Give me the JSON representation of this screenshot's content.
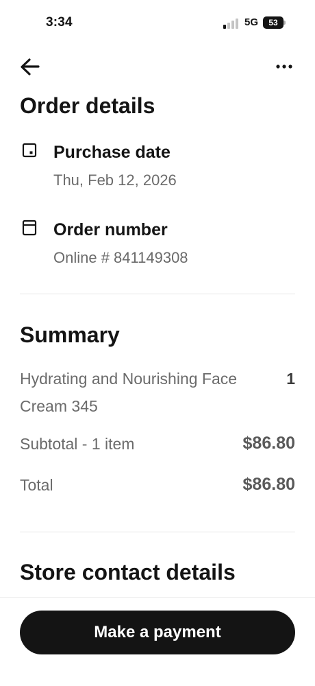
{
  "status_bar": {
    "time": "3:34",
    "network": "5G",
    "battery": "53"
  },
  "nav": {
    "back_icon": "arrow-left-icon",
    "more_icon": "more-horizontal-icon"
  },
  "page": {
    "title": "Order details"
  },
  "details": {
    "purchase_date": {
      "icon": "calendar-icon",
      "label": "Purchase date",
      "value": "Thu, Feb 12, 2026"
    },
    "order_number": {
      "icon": "receipt-icon",
      "label": "Order number",
      "value": "Online # 841149308"
    }
  },
  "summary": {
    "title": "Summary",
    "item": {
      "name": "Hydrating and Nourishing Face Cream 345",
      "quantity": "1"
    },
    "subtotal_label": "Subtotal - 1 item",
    "subtotal_value": "$86.80",
    "total_label": "Total",
    "total_value": "$86.80"
  },
  "store_contact": {
    "title": "Store contact details"
  },
  "actions": {
    "pay_label": "Make a payment"
  },
  "colors": {
    "text_primary": "#141414",
    "text_secondary": "#6b6b6b",
    "button_bg": "#141414",
    "divider": "#e6e6e6"
  }
}
